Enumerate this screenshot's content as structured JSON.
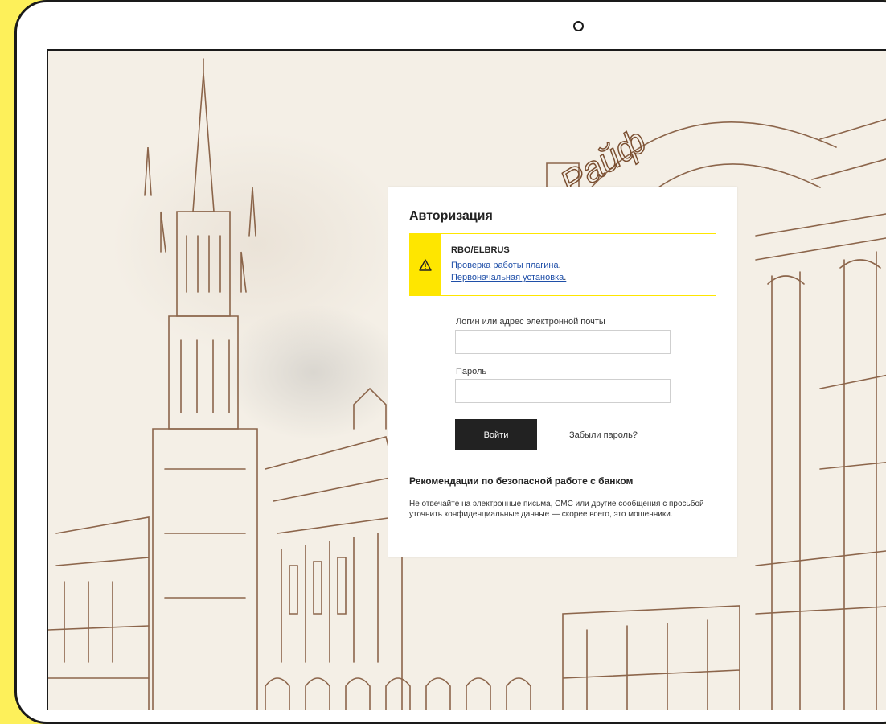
{
  "card": {
    "title": "Авторизация"
  },
  "alert": {
    "title": "RBO/ELBRUS",
    "link_plugin_check": "Проверка работы плагина",
    "link_initial_install": "Первоначальная установка",
    "link_suffix": ".",
    "icon": "warning-icon"
  },
  "login_form": {
    "login_label": "Логин или адрес электронной почты",
    "login_value": "",
    "password_label": "Пароль",
    "password_value": "",
    "submit_label": "Войти",
    "forgot_label": "Забыли пароль?"
  },
  "recommendations": {
    "title": "Рекомендации по безопасной работе с банком",
    "text": "Не отвечайте на электронные письма, СМС или другие сообщения с просьбой уточнить конфиденциальные данные — скорее всего, это мошенники."
  },
  "background": {
    "sign_text": "Райф"
  },
  "colors": {
    "brand_yellow": "#fee600",
    "page_background": "#fdf05a",
    "button_dark": "#222222",
    "link_blue": "#1f4fa8",
    "sketch_brown": "#7a4e30"
  }
}
